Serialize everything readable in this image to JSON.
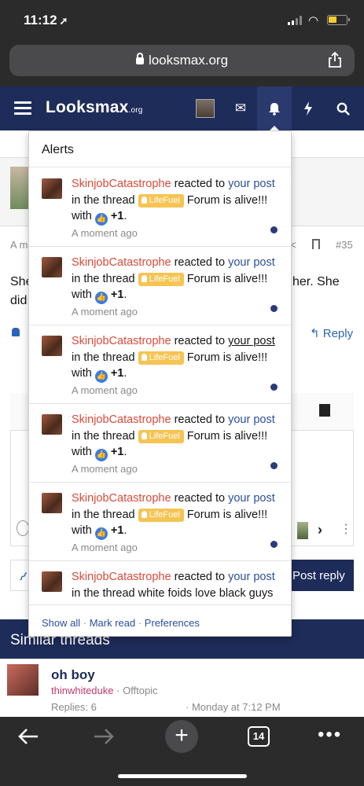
{
  "status_bar": {
    "time": "11:12",
    "location_arrow": "location-arrow-icon"
  },
  "browser": {
    "url": "looksmax.org"
  },
  "site": {
    "logo_text": "Looksmax",
    "logo_suffix": ".org"
  },
  "page": {
    "post_meta": "A m",
    "post_number": "#35",
    "post_text_line1": "She",
    "post_text_line2": "did",
    "post_text_right": "her. She",
    "reply_label": "Reply",
    "post_reply_button": "Post reply",
    "similar_threads_title": "Similar threads",
    "similar_thread": {
      "title": "oh boy",
      "author": "thinwhiteduke",
      "separator": " · ",
      "forum": "Offtopic",
      "replies": "Replies: 6",
      "date": "· Monday at 7:12 PM"
    }
  },
  "alerts": {
    "title": "Alerts",
    "items": [
      {
        "user": "SkinjobCatastrophe",
        "verb": " reacted to ",
        "target": "your post",
        "in_thread": "in the thread ",
        "prefix": "LifeFuel",
        "thread": " Forum is alive!!!",
        "with": "with ",
        "reaction": "+1",
        "time": "A moment ago"
      },
      {
        "user": "SkinjobCatastrophe",
        "verb": " reacted to ",
        "target": "your post",
        "in_thread": "in the thread ",
        "prefix": "LifeFuel",
        "thread": " Forum is alive!!!",
        "with": "with ",
        "reaction": "+1",
        "time": "A moment ago"
      },
      {
        "user": "SkinjobCatastrophe",
        "verb": " reacted to ",
        "target": "your post",
        "in_thread": "in the thread ",
        "prefix": "LifeFuel",
        "thread": " Forum is alive!!!",
        "with": "with ",
        "reaction": "+1",
        "time": "A moment ago"
      },
      {
        "user": "SkinjobCatastrophe",
        "verb": " reacted to ",
        "target": "your post",
        "in_thread": "in the thread ",
        "prefix": "LifeFuel",
        "thread": " Forum is alive!!!",
        "with": "with ",
        "reaction": "+1",
        "time": "A moment ago"
      },
      {
        "user": "SkinjobCatastrophe",
        "verb": " reacted to ",
        "target": "your post",
        "in_thread": "in the thread ",
        "prefix": "LifeFuel",
        "thread": " Forum is alive!!!",
        "with": "with ",
        "reaction": "+1",
        "time": "A moment ago"
      },
      {
        "user": "SkinjobCatastrophe",
        "verb": " reacted to ",
        "target": "your post",
        "in_thread": "in the thread white foids love black guys"
      }
    ],
    "footer": {
      "show_all": "Show all",
      "mark_read": "Mark read",
      "preferences": "Preferences",
      "sep": " · "
    }
  },
  "bottom_bar": {
    "tabs_count": "14"
  },
  "colors": {
    "nav_bg": "#1e2c5a",
    "username_red": "#d94a3a",
    "link_blue": "#2b4f9e",
    "prefix_yellow": "#f6c453",
    "unread_dot": "#2b3a7a"
  }
}
